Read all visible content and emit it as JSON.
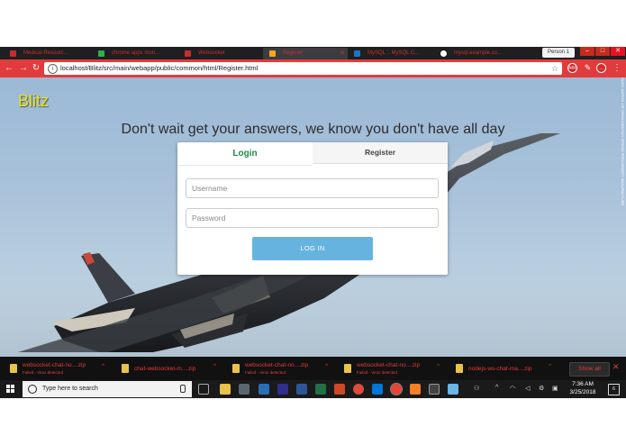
{
  "browser": {
    "tabs": [
      {
        "label": "Medical Resourc...",
        "icon_color": "#cc2b2b"
      },
      {
        "label": "chrome apps mon...",
        "icon_color": "#2fb14b"
      },
      {
        "label": "Websocket",
        "icon_color": "#cc2b2b"
      },
      {
        "label": "Register",
        "icon_color": "#f5a623"
      },
      {
        "label": "MySQL :: MySQL C...",
        "icon_color": "#1a73c9"
      },
      {
        "label": "mysql.example.co...",
        "icon_color": "#ffffff"
      }
    ],
    "profile": "Person 1",
    "url": "localhost/Blitz/src/main/webapp/public/common/html/Register.html",
    "extensions": [
      "ABP",
      "",
      "..."
    ]
  },
  "page": {
    "brand": "Blitz",
    "tagline": "Don't wait get your answers, we know you don't have all day",
    "side_text": "HARD NATION AIR ORGANIZATION SPRING PRELIMINARY MANUFACTURE STATS ORGANIZATION",
    "tabs": {
      "login": "Login",
      "register": "Register"
    },
    "form": {
      "username_placeholder": "Username",
      "password_placeholder": "Password",
      "submit": "LOG IN"
    }
  },
  "downloads": {
    "items": [
      {
        "name": "websocket-chat-no....zip",
        "status": "Failed - Virus detected"
      },
      {
        "name": "chat-websocket-m....zip",
        "status": ""
      },
      {
        "name": "websocket-chat-no....zip",
        "status": "Failed - Virus detected"
      },
      {
        "name": "websocket-chat-no....zip",
        "status": "Failed - Virus detected"
      },
      {
        "name": "nodejs-ws-chat-ma....zip",
        "status": ""
      }
    ],
    "show_all": "Show all"
  },
  "taskbar": {
    "search_placeholder": "Type here to search",
    "time": "7:36 AM",
    "date": "3/25/2018",
    "notifications": "6",
    "app_colors": [
      "#5b6770",
      "#e8c24a",
      "#2c6fb6",
      "#2f2f8f",
      "#2b579a",
      "#207245",
      "#d24726",
      "#dd4b39",
      "#0078d7",
      "#ea4335",
      "#f58025",
      "#444444",
      "#6bb5e8"
    ]
  }
}
